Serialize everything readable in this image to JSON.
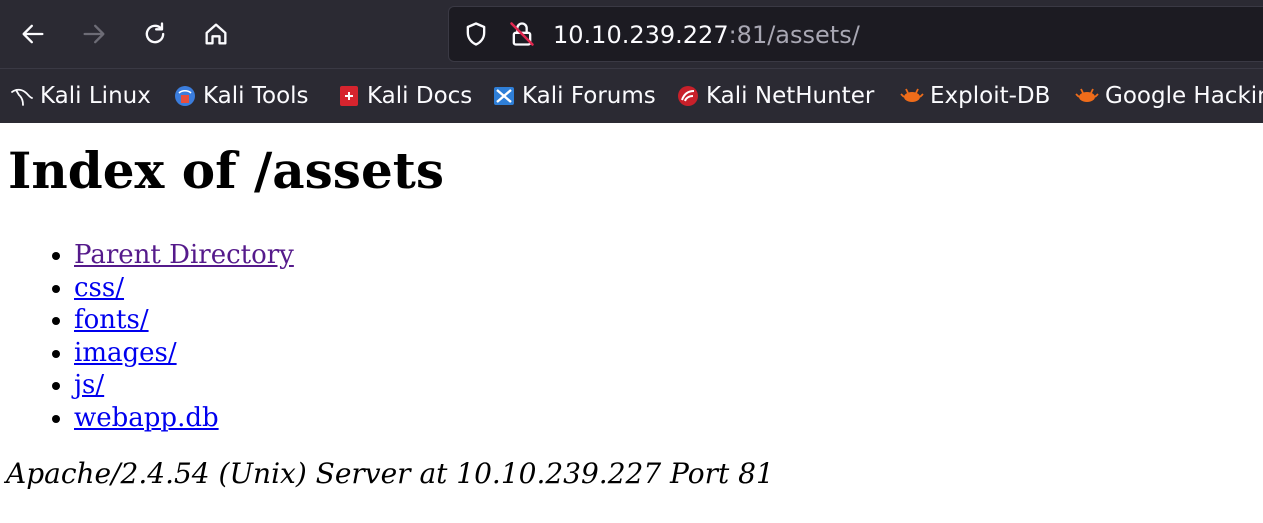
{
  "browser": {
    "url_host": "10.10.239.227",
    "url_rest": ":81/assets/",
    "bookmarks": [
      {
        "label": "Kali Linux",
        "icon": "kali-dragon-icon"
      },
      {
        "label": "Kali Tools",
        "icon": "kali-tools-icon"
      },
      {
        "label": "Kali Docs",
        "icon": "kali-docs-icon"
      },
      {
        "label": "Kali Forums",
        "icon": "kali-forums-icon"
      },
      {
        "label": "Kali NetHunter",
        "icon": "kali-nethunter-icon"
      },
      {
        "label": "Exploit-DB",
        "icon": "exploit-db-icon"
      },
      {
        "label": "Google Hackin",
        "icon": "google-hacking-icon"
      }
    ]
  },
  "page": {
    "title": "Index of /assets",
    "entries": [
      {
        "label": "Parent Directory",
        "visited": true
      },
      {
        "label": "css/",
        "visited": false
      },
      {
        "label": "fonts/",
        "visited": false
      },
      {
        "label": "images/",
        "visited": false
      },
      {
        "label": "js/",
        "visited": false
      },
      {
        "label": "webapp.db",
        "visited": false
      }
    ],
    "server_signature": "Apache/2.4.54 (Unix) Server at 10.10.239.227 Port 81"
  },
  "colors": {
    "toolbar_bg": "#2b2a33",
    "urlbar_bg": "#1c1b22",
    "link": "#0000ee",
    "visited_link": "#551a8b"
  }
}
